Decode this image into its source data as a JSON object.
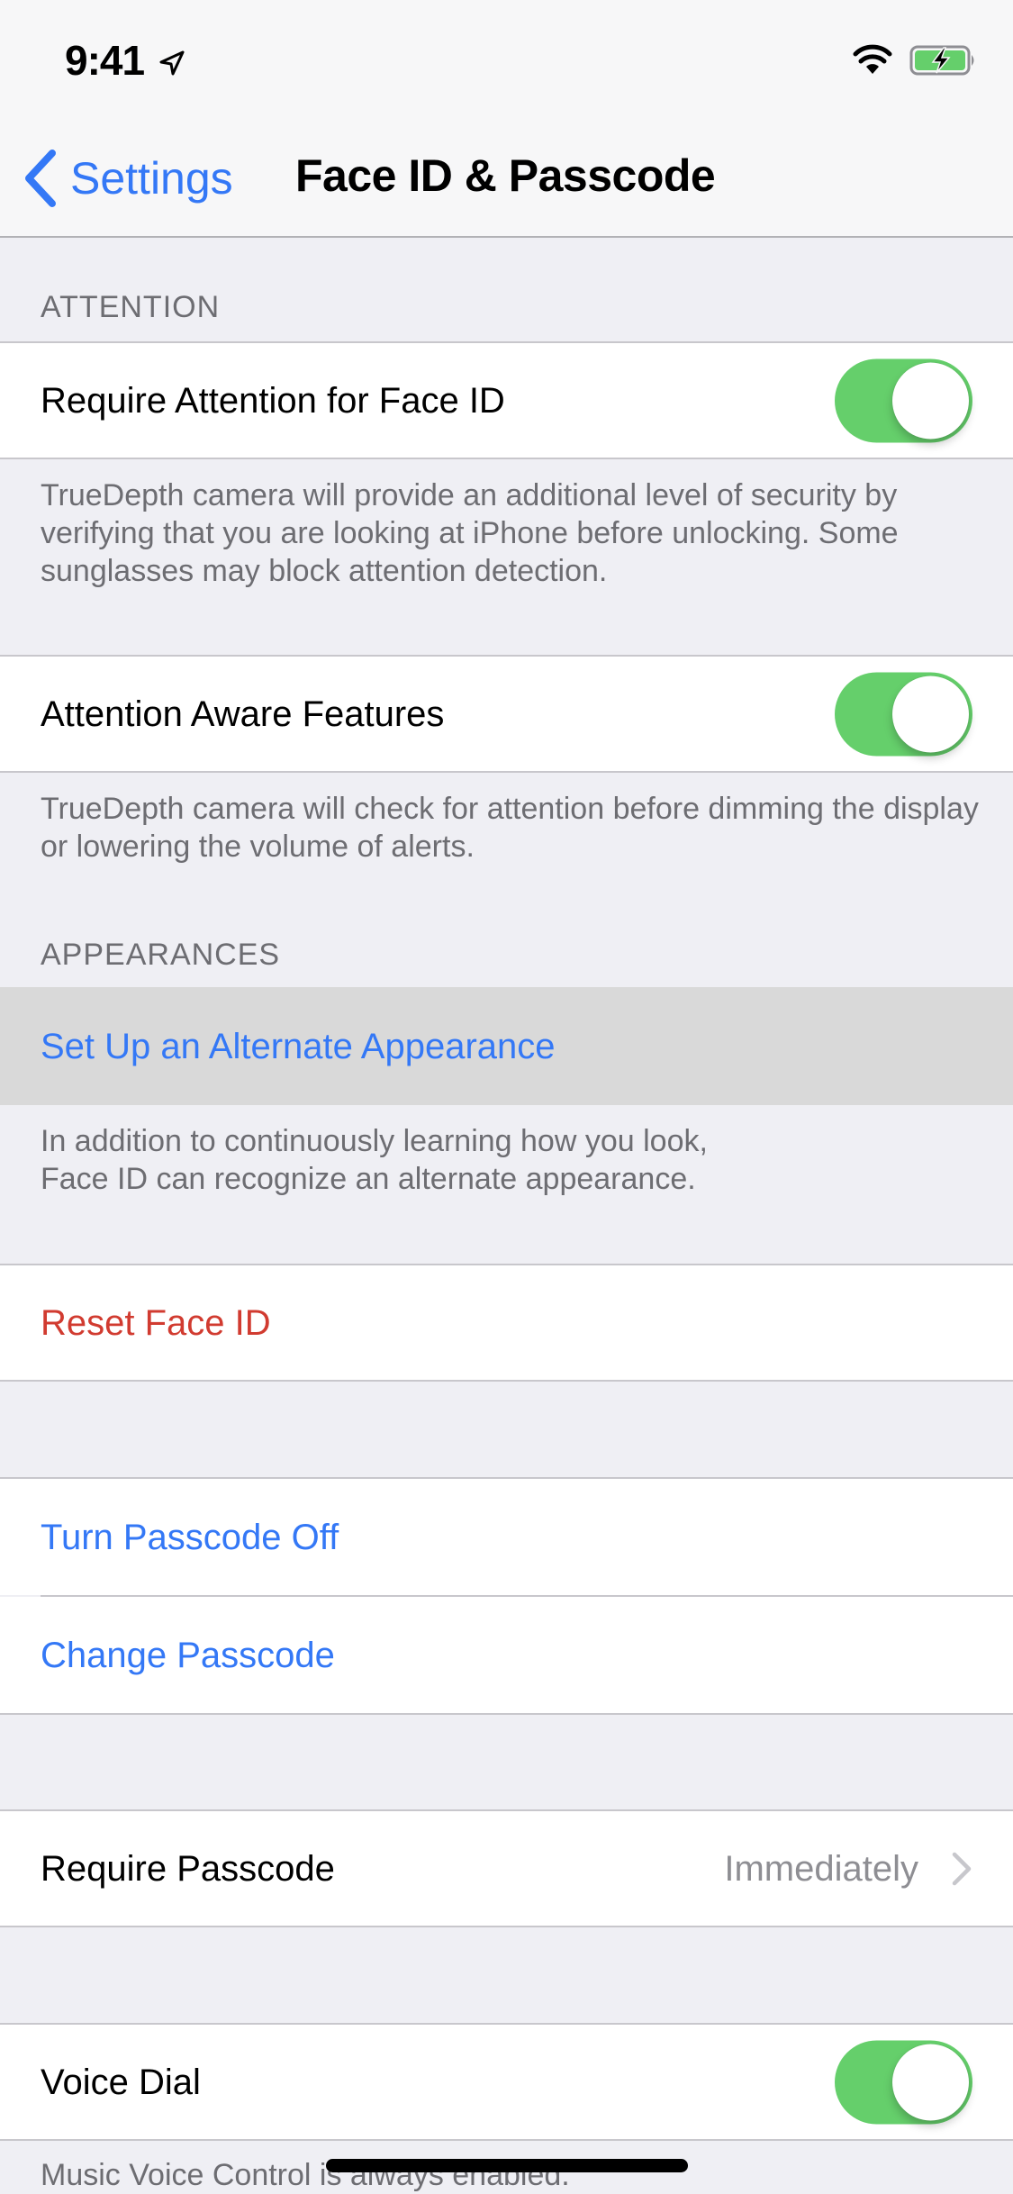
{
  "status_bar": {
    "time": "9:41",
    "icons": [
      "location-arrow-icon",
      "wifi-icon",
      "battery-charging-icon"
    ]
  },
  "nav": {
    "back_label": "Settings",
    "title": "Face ID & Passcode"
  },
  "sections": {
    "attention": {
      "header": "ATTENTION",
      "require_attention": {
        "label": "Require Attention for Face ID",
        "enabled": true,
        "footer": "TrueDepth camera will provide an additional level of security by verifying that you are looking at iPhone before unlocking. Some sunglasses may block attention detection."
      },
      "attention_aware": {
        "label": "Attention Aware Features",
        "enabled": true,
        "footer": "TrueDepth camera will check for attention before dimming the display or lowering the volume of alerts."
      }
    },
    "appearances": {
      "header": "APPEARANCES",
      "setup_alternate": {
        "label": "Set Up an Alternate Appearance",
        "footer_line1": "In addition to continuously learning how you look,",
        "footer_line2": "Face ID can recognize an alternate appearance."
      }
    },
    "reset": {
      "label": "Reset Face ID"
    },
    "passcode": {
      "turn_off_label": "Turn Passcode Off",
      "change_label": "Change Passcode"
    },
    "require_passcode": {
      "label": "Require Passcode",
      "value": "Immediately"
    },
    "voice_dial": {
      "label": "Voice Dial",
      "enabled": true,
      "footer": "Music Voice Control is always enabled."
    }
  },
  "colors": {
    "accent_blue": "#3478f6",
    "destructive_red": "#d13b30",
    "toggle_on_green": "#65cf6b",
    "grouped_background": "#efeff4"
  }
}
